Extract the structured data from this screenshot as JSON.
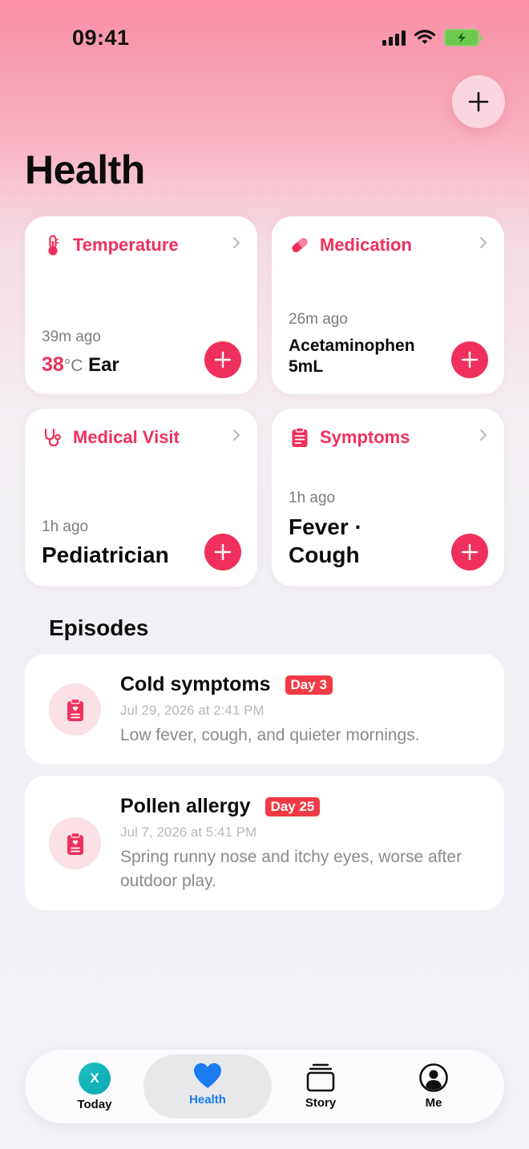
{
  "status": {
    "time": "09:41"
  },
  "page": {
    "title": "Health"
  },
  "cards": [
    {
      "title": "Temperature",
      "icon": "thermometer-icon",
      "ago": "39m ago",
      "value_num": "38",
      "value_unit": "°C",
      "value_text": "Ear"
    },
    {
      "title": "Medication",
      "icon": "pill-icon",
      "ago": "26m ago",
      "value_line1": "Acetaminophen",
      "value_line2": "5mL"
    },
    {
      "title": "Medical Visit",
      "icon": "stethoscope-icon",
      "ago": "1h ago",
      "value": "Pediatrician"
    },
    {
      "title": "Symptoms",
      "icon": "clipboard-icon",
      "ago": "1h ago",
      "value_line1": "Fever ·",
      "value_line2": "Cough"
    }
  ],
  "episodes_section": {
    "title": "Episodes"
  },
  "episodes": [
    {
      "title": "Cold symptoms",
      "badge": "Day 3",
      "date": "Jul 29, 2026 at 2:41 PM",
      "description": "Low fever, cough, and quieter mornings."
    },
    {
      "title": "Pollen allergy",
      "badge": "Day 25",
      "date": "Jul 7, 2026 at 5:41 PM",
      "description": "Spring runny nose and itchy eyes, worse after outdoor play."
    }
  ],
  "tabs": [
    {
      "label": "Today",
      "avatar_letter": "X",
      "icon": "avatar-icon"
    },
    {
      "label": "Health",
      "icon": "heart-icon",
      "active": true
    },
    {
      "label": "Story",
      "icon": "stack-icon"
    },
    {
      "label": "Me",
      "icon": "person-circle-icon"
    }
  ],
  "colors": {
    "accent": "#f0305c",
    "tab_active": "#1a7cf0",
    "badge": "#f03a45"
  }
}
